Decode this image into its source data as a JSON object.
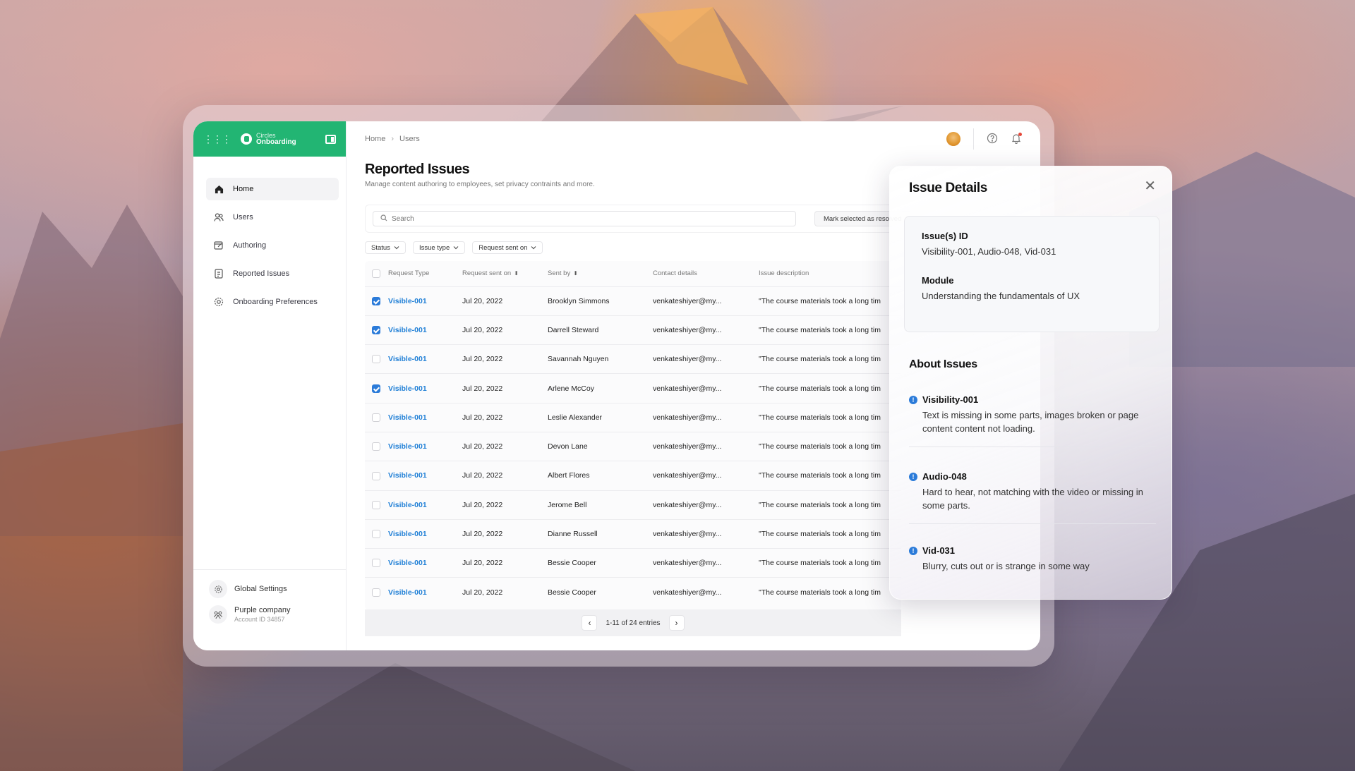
{
  "brand": {
    "line1": "Circles",
    "line2": "Onboarding"
  },
  "sidebar": {
    "items": [
      {
        "label": "Home",
        "icon": "home-icon",
        "active": true
      },
      {
        "label": "Users",
        "icon": "users-icon",
        "active": false
      },
      {
        "label": "Authoring",
        "icon": "authoring-icon",
        "active": false
      },
      {
        "label": "Reported Issues",
        "icon": "report-icon",
        "active": false
      },
      {
        "label": "Onboarding Preferences",
        "icon": "preferences-icon",
        "active": false
      }
    ],
    "global_settings": "Global Settings",
    "company": {
      "name": "Purple company",
      "account": "Account ID 34857"
    }
  },
  "breadcrumb": {
    "home": "Home",
    "current": "Users"
  },
  "page": {
    "title": "Reported Issues",
    "subtitle": "Manage content authoring to employees, set privacy contraints and more."
  },
  "toolbar": {
    "search_placeholder": "Search",
    "mark_button": "Mark selected as resolved"
  },
  "filters": [
    "Status",
    "Issue type",
    "Request sent on"
  ],
  "table": {
    "columns": [
      "Request Type",
      "Request sent on",
      "Sent by",
      "Contact details",
      "Issue description"
    ],
    "rows": [
      {
        "checked": true,
        "type": "Visible-001",
        "date": "Jul 20, 2022",
        "sender": "Brooklyn Simmons",
        "contact": "venkateshiyer@my...",
        "desc": "\"The course materials took a long tim"
      },
      {
        "checked": true,
        "type": "Visible-001",
        "date": "Jul 20, 2022",
        "sender": "Darrell Steward",
        "contact": "venkateshiyer@my...",
        "desc": "\"The course materials took a long tim"
      },
      {
        "checked": false,
        "type": "Visible-001",
        "date": "Jul 20, 2022",
        "sender": "Savannah Nguyen",
        "contact": "venkateshiyer@my...",
        "desc": "\"The course materials took a long tim"
      },
      {
        "checked": true,
        "type": "Visible-001",
        "date": "Jul 20, 2022",
        "sender": "Arlene McCoy",
        "contact": "venkateshiyer@my...",
        "desc": "\"The course materials took a long tim"
      },
      {
        "checked": false,
        "type": "Visible-001",
        "date": "Jul 20, 2022",
        "sender": "Leslie Alexander",
        "contact": "venkateshiyer@my...",
        "desc": "\"The course materials took a long tim"
      },
      {
        "checked": false,
        "type": "Visible-001",
        "date": "Jul 20, 2022",
        "sender": "Devon Lane",
        "contact": "venkateshiyer@my...",
        "desc": "\"The course materials took a long tim"
      },
      {
        "checked": false,
        "type": "Visible-001",
        "date": "Jul 20, 2022",
        "sender": "Albert Flores",
        "contact": "venkateshiyer@my...",
        "desc": "\"The course materials took a long tim"
      },
      {
        "checked": false,
        "type": "Visible-001",
        "date": "Jul 20, 2022",
        "sender": "Jerome Bell",
        "contact": "venkateshiyer@my...",
        "desc": "\"The course materials took a long tim"
      },
      {
        "checked": false,
        "type": "Visible-001",
        "date": "Jul 20, 2022",
        "sender": "Dianne Russell",
        "contact": "venkateshiyer@my...",
        "desc": "\"The course materials took a long tim"
      },
      {
        "checked": false,
        "type": "Visible-001",
        "date": "Jul 20, 2022",
        "sender": "Bessie Cooper",
        "contact": "venkateshiyer@my...",
        "desc": "\"The course materials took a long tim"
      },
      {
        "checked": false,
        "type": "Visible-001",
        "date": "Jul 20, 2022",
        "sender": "Bessie Cooper",
        "contact": "venkateshiyer@my...",
        "desc": "\"The course materials took a long tim"
      }
    ]
  },
  "pagination": {
    "text": "1-11 of 24 entries"
  },
  "panel": {
    "title": "Issue Details",
    "ids_label": "Issue(s) ID",
    "ids_value": "Visibility-001, Audio-048, Vid-031",
    "module_label": "Module",
    "module_value": "Understanding the fundamentals of UX",
    "about_title": "About Issues",
    "issues": [
      {
        "name": "Visibility-001",
        "desc": "Text is missing in some parts, images broken or page content content not loading."
      },
      {
        "name": "Audio-048",
        "desc": "Hard to hear, not matching with the video or missing in some parts."
      },
      {
        "name": "Vid-031",
        "desc": "Blurry, cuts out or is strange in some way"
      }
    ]
  },
  "colors": {
    "brand": "#22b573",
    "accent": "#2b7bd9",
    "link": "#1f7fd6"
  }
}
